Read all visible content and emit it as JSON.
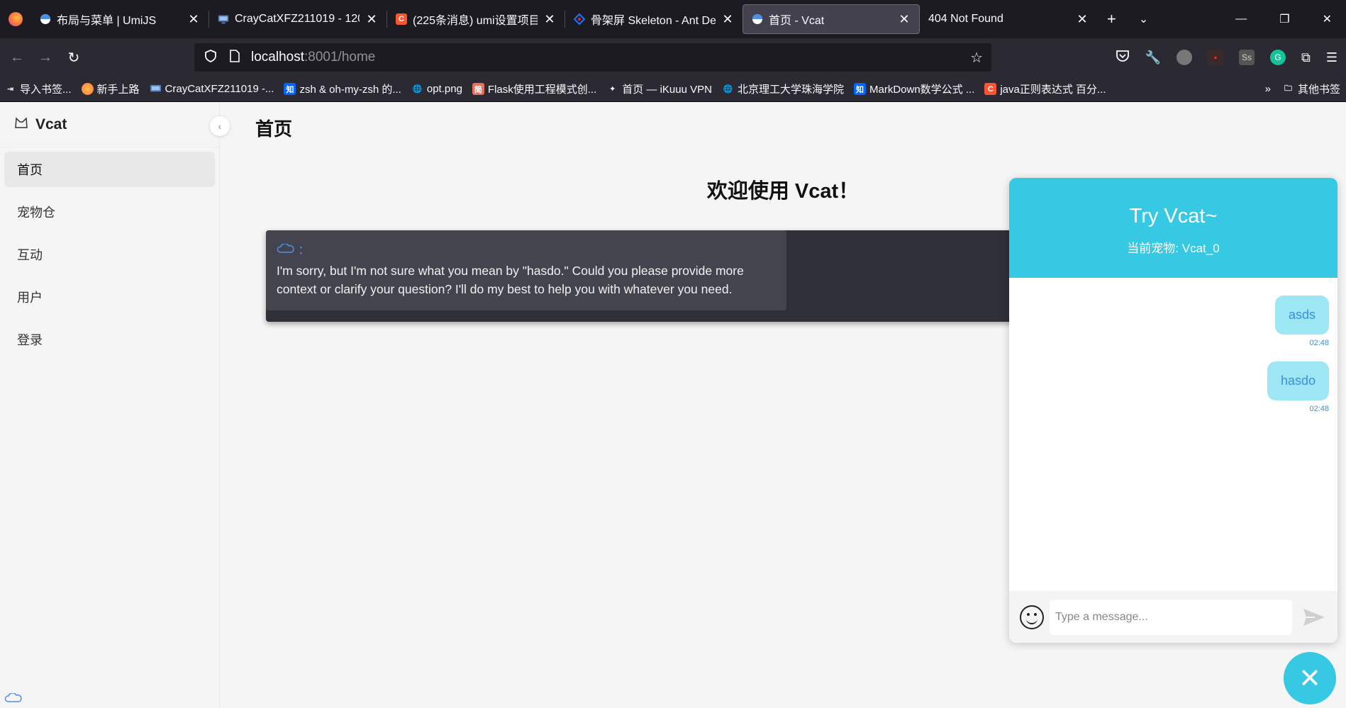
{
  "browser": {
    "tabs": [
      {
        "title": "布局与菜单 | UmiJS",
        "icon_color": "#4a90e2",
        "icon": "umi-icon"
      },
      {
        "title": "CrayCatXFZ211019 - 120...",
        "icon_color": "#5a7fb5",
        "icon": "monitor-icon"
      },
      {
        "title": "(225条消息) umi设置项目...",
        "icon_color": "#fc5531",
        "icon_text": "C"
      },
      {
        "title": "骨架屏 Skeleton - Ant Des...",
        "icon_color": "#1677ff",
        "icon": "antd-icon"
      },
      {
        "title": "首页 - Vcat",
        "icon_color": "#4a90e2",
        "icon": "vcat-tab-icon",
        "active": true
      },
      {
        "title": "404 Not Found",
        "icon": "none"
      }
    ],
    "url_host": "localhost",
    "url_rest": ":8001/home",
    "bookmarks": [
      {
        "label": "导入书签...",
        "icon": "import-icon",
        "color": "#2b2a33"
      },
      {
        "label": "新手上路",
        "icon": "firefox-icon",
        "color": "#ff7139"
      },
      {
        "label": "CrayCatXFZ211019 -...",
        "icon": "monitor-icon",
        "color": "#5a7fb5"
      },
      {
        "label": "zsh & oh-my-zsh 的...",
        "icon_text": "知",
        "color": "#0066ff"
      },
      {
        "label": "opt.png",
        "icon": "globe-icon",
        "color": "#2b2a33"
      },
      {
        "label": "Flask使用工程模式创...",
        "icon_text": "简",
        "color": "#ea6f5a"
      },
      {
        "label": "首页 — iKuuu VPN",
        "icon": "vpn-icon",
        "color": "#2b2a33"
      },
      {
        "label": "北京理工大学珠海学院",
        "icon": "globe-icon",
        "color": "#2b2a33"
      },
      {
        "label": "MarkDown数学公式 ...",
        "icon_text": "知",
        "color": "#0066ff"
      },
      {
        "label": "java正则表达式 百分...",
        "icon_text": "C",
        "color": "#fc5531"
      }
    ],
    "other_bookmarks": "其他书签"
  },
  "sidebar": {
    "brand": "Vcat",
    "items": [
      {
        "label": "首页",
        "selected": true
      },
      {
        "label": "宠物仓"
      },
      {
        "label": "互动"
      },
      {
        "label": "用户"
      },
      {
        "label": "登录"
      }
    ]
  },
  "main": {
    "page_title": "首页",
    "welcome": "欢迎使用 Vcat！",
    "reply_prefix": "：",
    "reply_text": "I'm sorry, but I'm not sure what you mean by \"hasdo.\" Could you please provide more context or clarify your question? I'll do my best to help you with whatever you need."
  },
  "chat": {
    "title": "Try Vcat~",
    "subtitle": "当前宠物: Vcat_0",
    "messages": [
      {
        "text": "asds",
        "time": "02:48"
      },
      {
        "text": "hasdo",
        "time": "02:48"
      }
    ],
    "input_placeholder": "Type a message...",
    "accent": "#37c8e3"
  }
}
